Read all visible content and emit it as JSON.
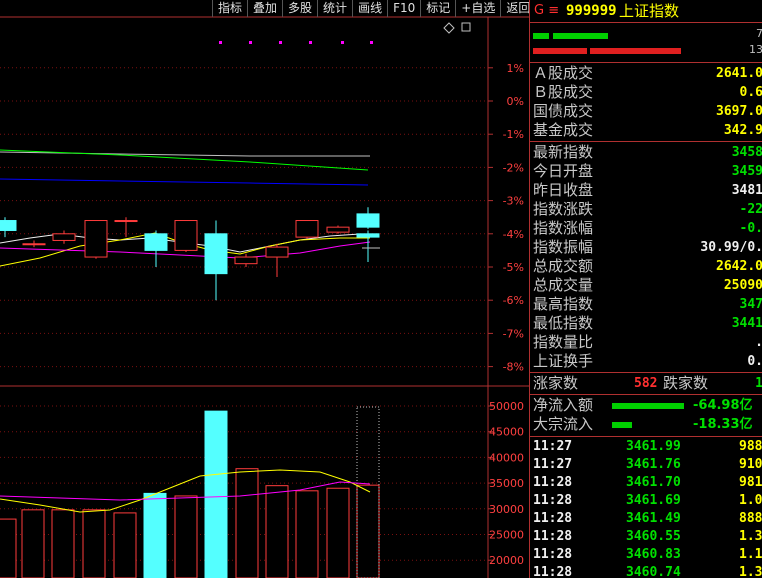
{
  "toolbar": {
    "buttons": [
      "指标",
      "叠加",
      "多股",
      "统计",
      "画线",
      "F10",
      "标记",
      "+自选",
      "返回"
    ]
  },
  "chart": {
    "pct_labels": [
      "1%",
      "0%",
      "-1%",
      "-2%",
      "-3%",
      "-4%",
      "-5%",
      "-6%",
      "-7%",
      "-8%"
    ],
    "vol_labels": [
      "50000",
      "45000",
      "40000",
      "35000",
      "30000",
      "25000",
      "20000"
    ],
    "colors": {
      "up": "#ff3c3c",
      "down": "#54ffff",
      "ma1": "#f0f0f0",
      "ma2": "#ffff00",
      "ma3": "#ff00ff",
      "ma4": "#00ff00",
      "ma5": "#0000ff",
      "ma6": "#c0c0c0",
      "grid": "#7a1010",
      "axis": "#b03030",
      "label": "#ff4040"
    }
  },
  "chart_data": {
    "type": "candlestick",
    "candles": [
      {
        "o": -3.6,
        "c": -3.9,
        "h": -3.5,
        "l": -4.1,
        "up": false
      },
      {
        "o": -4.3,
        "c": -4.3,
        "h": -4.2,
        "l": -4.4,
        "up": true
      },
      {
        "o": -4.2,
        "c": -4.0,
        "h": -3.9,
        "l": -4.3,
        "up": true
      },
      {
        "o": -4.7,
        "c": -3.6,
        "h": -3.6,
        "l": -4.75,
        "up": true
      },
      {
        "o": -3.6,
        "c": -3.6,
        "h": -3.5,
        "l": -4.1,
        "up": true
      },
      {
        "o": -4.0,
        "c": -4.5,
        "h": -3.9,
        "l": -5.0,
        "up": false
      },
      {
        "o": -4.5,
        "c": -3.6,
        "h": -3.6,
        "l": -4.55,
        "up": true
      },
      {
        "o": -4.0,
        "c": -5.2,
        "h": -3.6,
        "l": -6.0,
        "up": false
      },
      {
        "o": -4.9,
        "c": -4.7,
        "h": -4.6,
        "l": -5.0,
        "up": true
      },
      {
        "o": -4.4,
        "c": -4.7,
        "h": -4.3,
        "l": -5.3,
        "up": true
      },
      {
        "o": -4.1,
        "c": -3.6,
        "h": -3.6,
        "l": -4.15,
        "up": true
      },
      {
        "o": -3.95,
        "c": -3.8,
        "h": -3.75,
        "l": -4.0,
        "up": true
      },
      {
        "o": -3.4,
        "c": -3.8,
        "h": -3.2,
        "l": -3.85,
        "up": false
      },
      {
        "o": -4.0,
        "c": -4.1,
        "h": -3.9,
        "l": -4.85,
        "up": false
      }
    ],
    "volumes": [
      29500,
      31500,
      32000,
      30000,
      32000,
      28000,
      30500,
      34000,
      34500,
      40500,
      30000,
      35500,
      38500,
      41500,
      40000,
      49000,
      33000,
      33000,
      26000,
      27000,
      26500,
      31000,
      33000,
      35000,
      22000,
      30000
    ],
    "vol_bars": [
      {
        "v": 28000,
        "up": true
      },
      {
        "v": 29800,
        "up": true
      },
      {
        "v": 29800,
        "up": true
      },
      {
        "v": 29800,
        "up": true
      },
      {
        "v": 29200,
        "up": true
      },
      {
        "v": 33000,
        "up": false
      },
      {
        "v": 32500,
        "up": true
      },
      {
        "v": 49000,
        "up": false
      },
      {
        "v": 37800,
        "up": true
      },
      {
        "v": 34500,
        "up": true
      },
      {
        "v": 33500,
        "up": true
      },
      {
        "v": 34000,
        "up": true
      },
      {
        "v": 34600,
        "up": true
      },
      {
        "v": 41100,
        "up": false
      },
      {
        "v": 25400,
        "up": false
      }
    ],
    "ylim": [
      -8.5,
      1.5
    ],
    "vol_lim": [
      17000,
      52500
    ]
  },
  "quote": {
    "title_prefix": "G ≡",
    "code": "999999",
    "name": "上证指数",
    "bar_value1": "7",
    "bar_value2": "13",
    "rows": [
      {
        "label": "Ａ股成交",
        "value": "2641.0"
      },
      {
        "label": "Ｂ股成交",
        "value": "0.6"
      },
      {
        "label": "国债成交",
        "value": "3697.0"
      },
      {
        "label": "基金成交",
        "value": "342.9"
      },
      {
        "label": "最新指数",
        "value": "3458"
      },
      {
        "label": "今日开盘",
        "value": "3459"
      },
      {
        "label": "昨日收盘",
        "value": "3481"
      },
      {
        "label": "指数涨跌",
        "value": "-22"
      },
      {
        "label": "指数涨幅",
        "value": "-0."
      },
      {
        "label": "指数振幅",
        "value": "30.99/0."
      },
      {
        "label": "总成交额",
        "value": "2642.0"
      },
      {
        "label": "总成交量",
        "value": "25090"
      },
      {
        "label": "最高指数",
        "value": "347"
      },
      {
        "label": "最低指数",
        "value": "3441"
      },
      {
        "label": "指数量比",
        "value": "."
      },
      {
        "label": "上证换手",
        "value": "0."
      }
    ],
    "advance_label": "涨家数",
    "advance_value": "582",
    "decline_label": "跌家数",
    "decline_value": "1",
    "net_inflow_label": "净流入额",
    "net_inflow_value": "-64.98亿",
    "block_inflow_label": "大宗流入",
    "block_inflow_value": "-18.33亿",
    "ticks": [
      {
        "t": "11:27",
        "p": "3461.99",
        "v": "988"
      },
      {
        "t": "11:27",
        "p": "3461.76",
        "v": "910"
      },
      {
        "t": "11:28",
        "p": "3461.70",
        "v": "981"
      },
      {
        "t": "11:28",
        "p": "3461.69",
        "p2": "",
        "v": "1.0"
      },
      {
        "t": "11:28",
        "p": "3461.49",
        "v": "888"
      },
      {
        "t": "11:28",
        "p": "3460.55",
        "v": "1.3"
      },
      {
        "t": "11:28",
        "p": "3460.83",
        "v": "1.1"
      },
      {
        "t": "11:28",
        "p": "3460.74",
        "v": "1.3"
      }
    ]
  }
}
